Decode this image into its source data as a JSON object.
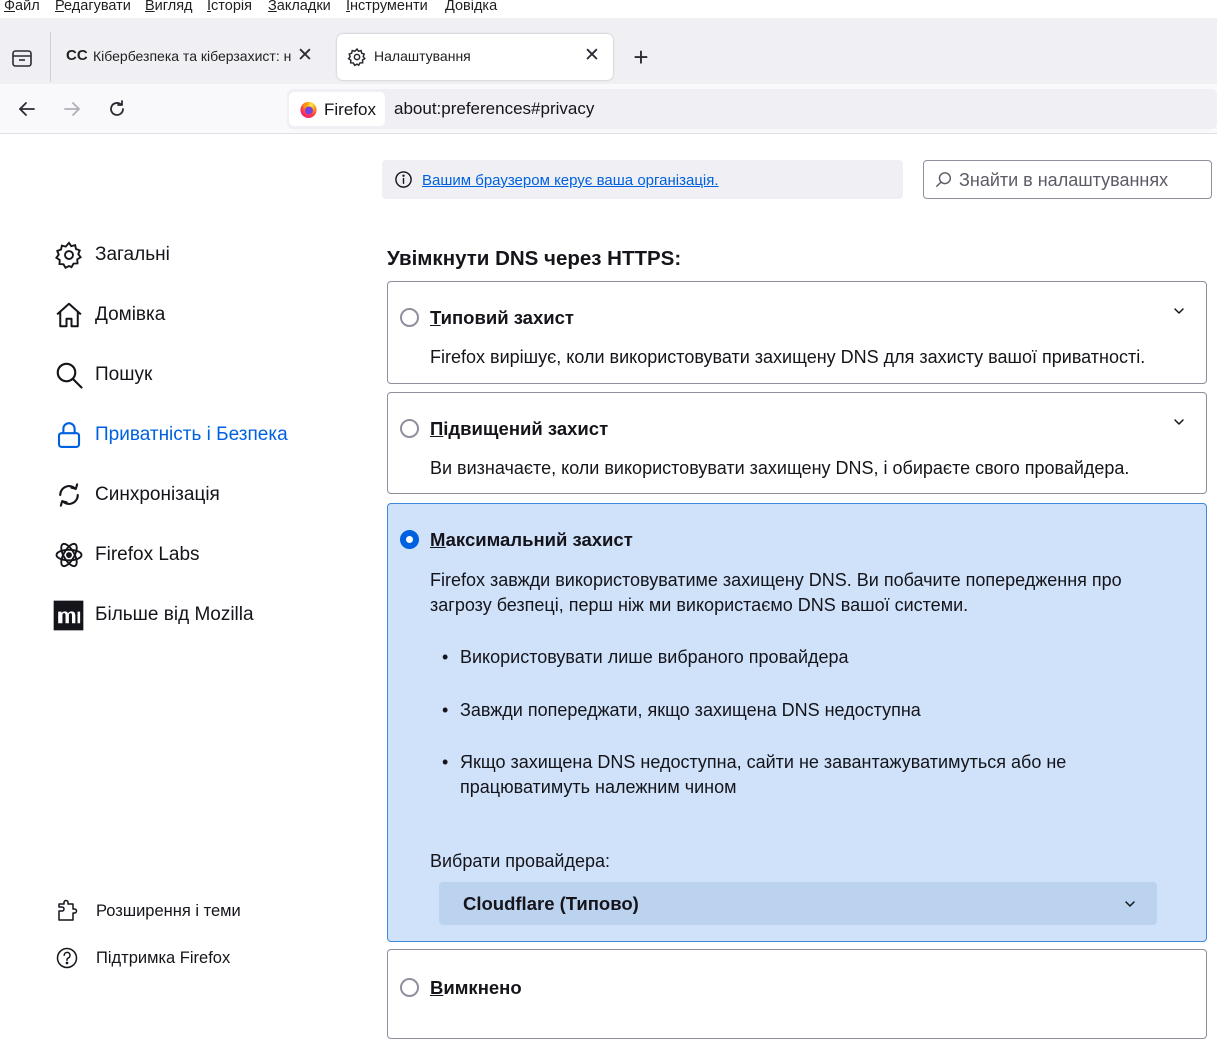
{
  "menubar": {
    "items": [
      {
        "label": "Файл",
        "ak": "Ф",
        "rest": "айл"
      },
      {
        "label": "Редагувати",
        "ak": "Р",
        "rest": "едагувати"
      },
      {
        "label": "Вигляд",
        "ak": "В",
        "rest": "игляд"
      },
      {
        "label": "Історія",
        "ak": "І",
        "rest": "сторія"
      },
      {
        "label": "Закладки",
        "ak": "З",
        "rest": "акладки"
      },
      {
        "label": "Інструменти",
        "ak": "І",
        "rest": "нструменти"
      },
      {
        "label": "Довідка",
        "ak": "Д",
        "rest": "овідка"
      }
    ]
  },
  "tabs": [
    {
      "title": "Кібербезпека та кіберзахист: н",
      "favicon": "CC",
      "close": "✕",
      "active": false
    },
    {
      "title": "Налаштування",
      "close": "✕",
      "active": true
    }
  ],
  "new_tab": "+",
  "urlbar": {
    "identity_label": "Firefox",
    "url": "about:preferences#privacy"
  },
  "policy": {
    "link": "Вашим браузером керує ваша організація."
  },
  "search": {
    "placeholder": "Знайти в налаштуваннях"
  },
  "sidebar": {
    "categories": [
      {
        "label": "Загальні",
        "icon": "gear-icon"
      },
      {
        "label": "Домівка",
        "icon": "home-icon"
      },
      {
        "label": "Пошук",
        "icon": "search-icon"
      },
      {
        "label": "Приватність і Безпека",
        "icon": "lock-icon",
        "selected": true
      },
      {
        "label": "Синхронізація",
        "icon": "sync-icon"
      },
      {
        "label": "Firefox Labs",
        "icon": "atom-icon"
      },
      {
        "label": "Більше від Mozilla",
        "icon": "mozilla-icon"
      }
    ],
    "footer": [
      {
        "label": "Розширення і теми",
        "icon": "puzzle-icon"
      },
      {
        "label": "Підтримка Firefox",
        "icon": "help-icon"
      }
    ]
  },
  "dns": {
    "heading": "Увімкнути DNS через HTTPS:",
    "options": [
      {
        "title": "Типовий захист",
        "ak": "Т",
        "rest": "иповий захист",
        "desc": "Firefox вирішує, коли використовувати захищену DNS для захисту вашої приватності.",
        "selected": false
      },
      {
        "title": "Підвищений захист",
        "ak": "П",
        "rest": "ідвищений захист",
        "desc": "Ви визначаєте, коли використовувати захищену DNS, і обираєте свого провайдера.",
        "selected": false
      },
      {
        "title": "Максимальний захист",
        "ak": "М",
        "rest": "аксимальний захист",
        "desc": "Firefox завжди використовуватиме захищену DNS. Ви побачите попередження про загрозу безпеці, перш ніж ми використаємо DNS вашої системи.",
        "bullets": [
          "Використовувати лише вибраного провайдера",
          "Завжди попереджати, якщо захищена DNS недоступна",
          "Якщо захищена DNS недоступна, сайти не завантажуватимуться або не працюватимуть належним чином"
        ],
        "provider_label": "Вибрати провайдера:",
        "provider_value": "Cloudflare (Типово)",
        "selected": true
      },
      {
        "title": "Вимкнено",
        "ak": "В",
        "rest": "имкнено",
        "selected": false
      }
    ]
  },
  "colors": {
    "accent": "#0061e0",
    "selected_card_bg": "#cfe2fa",
    "selected_card_border": "#3f8ad6"
  }
}
